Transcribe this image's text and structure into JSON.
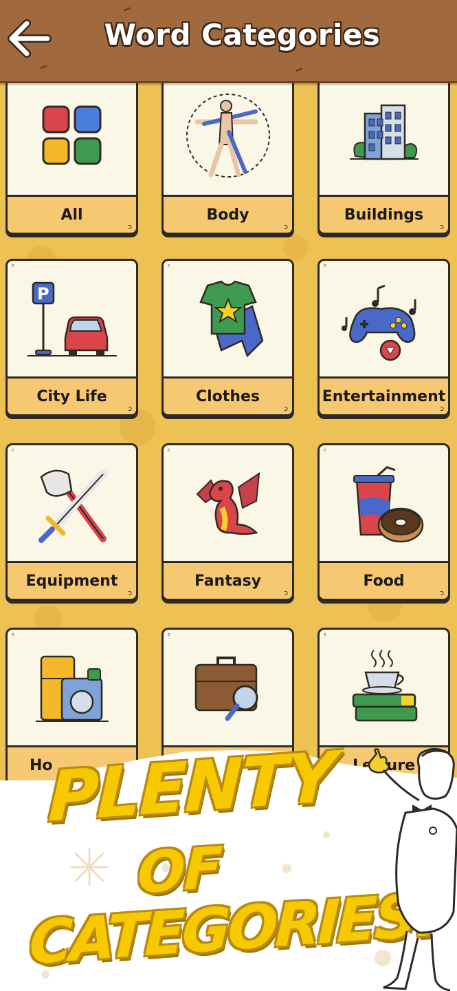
{
  "header": {
    "title": "Word Categories",
    "back_icon": "back-arrow-icon"
  },
  "categories": [
    {
      "label": "All",
      "icon": "four-squares-icon"
    },
    {
      "label": "Body",
      "icon": "vitruvian-man-icon"
    },
    {
      "label": "Buildings",
      "icon": "office-building-icon"
    },
    {
      "label": "City Life",
      "icon": "parking-car-icon"
    },
    {
      "label": "Clothes",
      "icon": "tshirt-jeans-icon"
    },
    {
      "label": "Entertainment",
      "icon": "gamepad-icon"
    },
    {
      "label": "Equipment",
      "icon": "axe-sword-icon"
    },
    {
      "label": "Fantasy",
      "icon": "dragon-icon"
    },
    {
      "label": "Food",
      "icon": "drink-donut-icon"
    },
    {
      "label": "Ho",
      "icon": "fridge-washer-icon"
    },
    {
      "label": "",
      "icon": "briefcase-magnifier-icon"
    },
    {
      "label": "Leisure",
      "icon": "tea-books-icon"
    }
  ],
  "promo": {
    "line1": "PLENTY",
    "line2": "OF",
    "line3": "CATEGORIES!"
  },
  "colors": {
    "header_bg": "#a06a3e",
    "page_bg": "#eec155",
    "card_bg": "#fbf7e6",
    "label_bar": "#f6c872",
    "promo_text": "#f6c900"
  }
}
